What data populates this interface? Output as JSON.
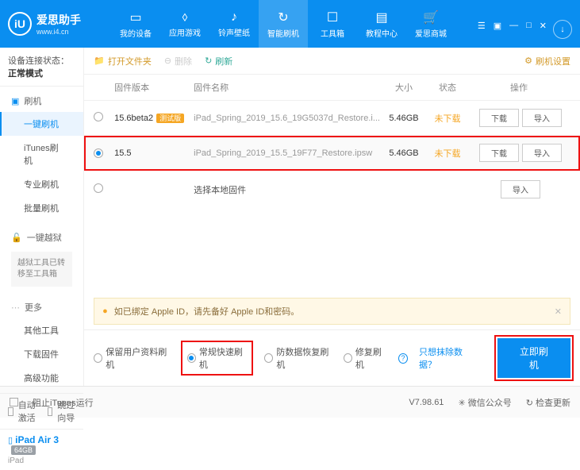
{
  "app": {
    "name": "爱思助手",
    "url": "www.i4.cn"
  },
  "nav": {
    "items": [
      {
        "label": "我的设备"
      },
      {
        "label": "应用游戏"
      },
      {
        "label": "铃声壁纸"
      },
      {
        "label": "智能刷机"
      },
      {
        "label": "工具箱"
      },
      {
        "label": "教程中心"
      },
      {
        "label": "爱思商城"
      }
    ]
  },
  "sidebar": {
    "conn_label": "设备连接状态：",
    "conn_value": "正常模式",
    "g1": {
      "head": "刷机",
      "items": [
        "一键刷机",
        "iTunes刷机",
        "专业刷机",
        "批量刷机"
      ]
    },
    "g2": {
      "head": "一键越狱",
      "note": "越狱工具已转移至工具箱"
    },
    "g3": {
      "head": "更多",
      "items": [
        "其他工具",
        "下载固件",
        "高级功能"
      ]
    },
    "auto_act": "自动激活",
    "skip_guide": "跳过向导",
    "device": {
      "name": "iPad Air 3",
      "cap": "64GB",
      "type": "iPad"
    }
  },
  "toolbar": {
    "open": "打开文件夹",
    "delete": "删除",
    "refresh": "刷新",
    "settings": "刷机设置"
  },
  "table": {
    "headers": {
      "ver": "固件版本",
      "name": "固件名称",
      "size": "大小",
      "stat": "状态",
      "ops": "操作"
    },
    "rows": [
      {
        "ver": "15.6beta2",
        "badge": "测试版",
        "name": "iPad_Spring_2019_15.6_19G5037d_Restore.i...",
        "size": "5.46GB",
        "stat": "未下载",
        "selected": false
      },
      {
        "ver": "15.5",
        "badge": "",
        "name": "iPad_Spring_2019_15.5_19F77_Restore.ipsw",
        "size": "5.46GB",
        "stat": "未下载",
        "selected": true
      }
    ],
    "local": "选择本地固件",
    "btn_dl": "下载",
    "btn_imp": "导入"
  },
  "notice": "如已绑定 Apple ID，请先备好 Apple ID和密码。",
  "options": {
    "o1": "保留用户资料刷机",
    "o2": "常规快速刷机",
    "o3": "防数据恢复刷机",
    "o4": "修复刷机",
    "link": "只想抹除数据？",
    "go": "立即刷机"
  },
  "footer": {
    "block": "阻止iTunes运行",
    "ver": "V7.98.61",
    "wx": "微信公众号",
    "upd": "检查更新"
  }
}
